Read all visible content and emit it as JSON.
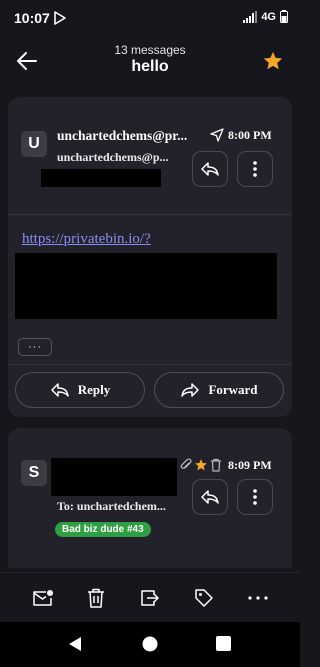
{
  "status": {
    "time": "10:07",
    "network": "4G"
  },
  "header": {
    "count": "13 messages",
    "title": "hello"
  },
  "message1": {
    "avatar": "U",
    "sender": "unchartedchems@pr...",
    "sender_sub": "unchartedchems@p...",
    "time": "8:00 PM",
    "link": "https://privatebin.io/?",
    "more": "···",
    "reply": "Reply",
    "forward": "Forward"
  },
  "message2": {
    "avatar": "S",
    "time": "8:09 PM",
    "to": "To: unchartedchem...",
    "tag": "Bad biz dude #43",
    "tag_color": "#2ea043"
  },
  "icons": {
    "status": [
      "play-store-icon",
      "signal-icon",
      "battery-icon"
    ],
    "header": [
      "back-arrow-icon",
      "star-icon"
    ],
    "message": [
      "sent-icon",
      "reply-icon",
      "more-vertical-icon",
      "attachment-icon",
      "star-icon",
      "trash-icon"
    ],
    "toolbar": [
      "mark-unread-icon",
      "trash-icon",
      "move-icon",
      "label-icon",
      "more-horizontal-icon"
    ],
    "system": [
      "nav-back-icon",
      "nav-home-icon",
      "nav-recents-icon"
    ]
  },
  "colors": {
    "accent_star": "#f5a623",
    "link": "#8a8cf4",
    "background": "#17161c",
    "card": "#23222a"
  }
}
